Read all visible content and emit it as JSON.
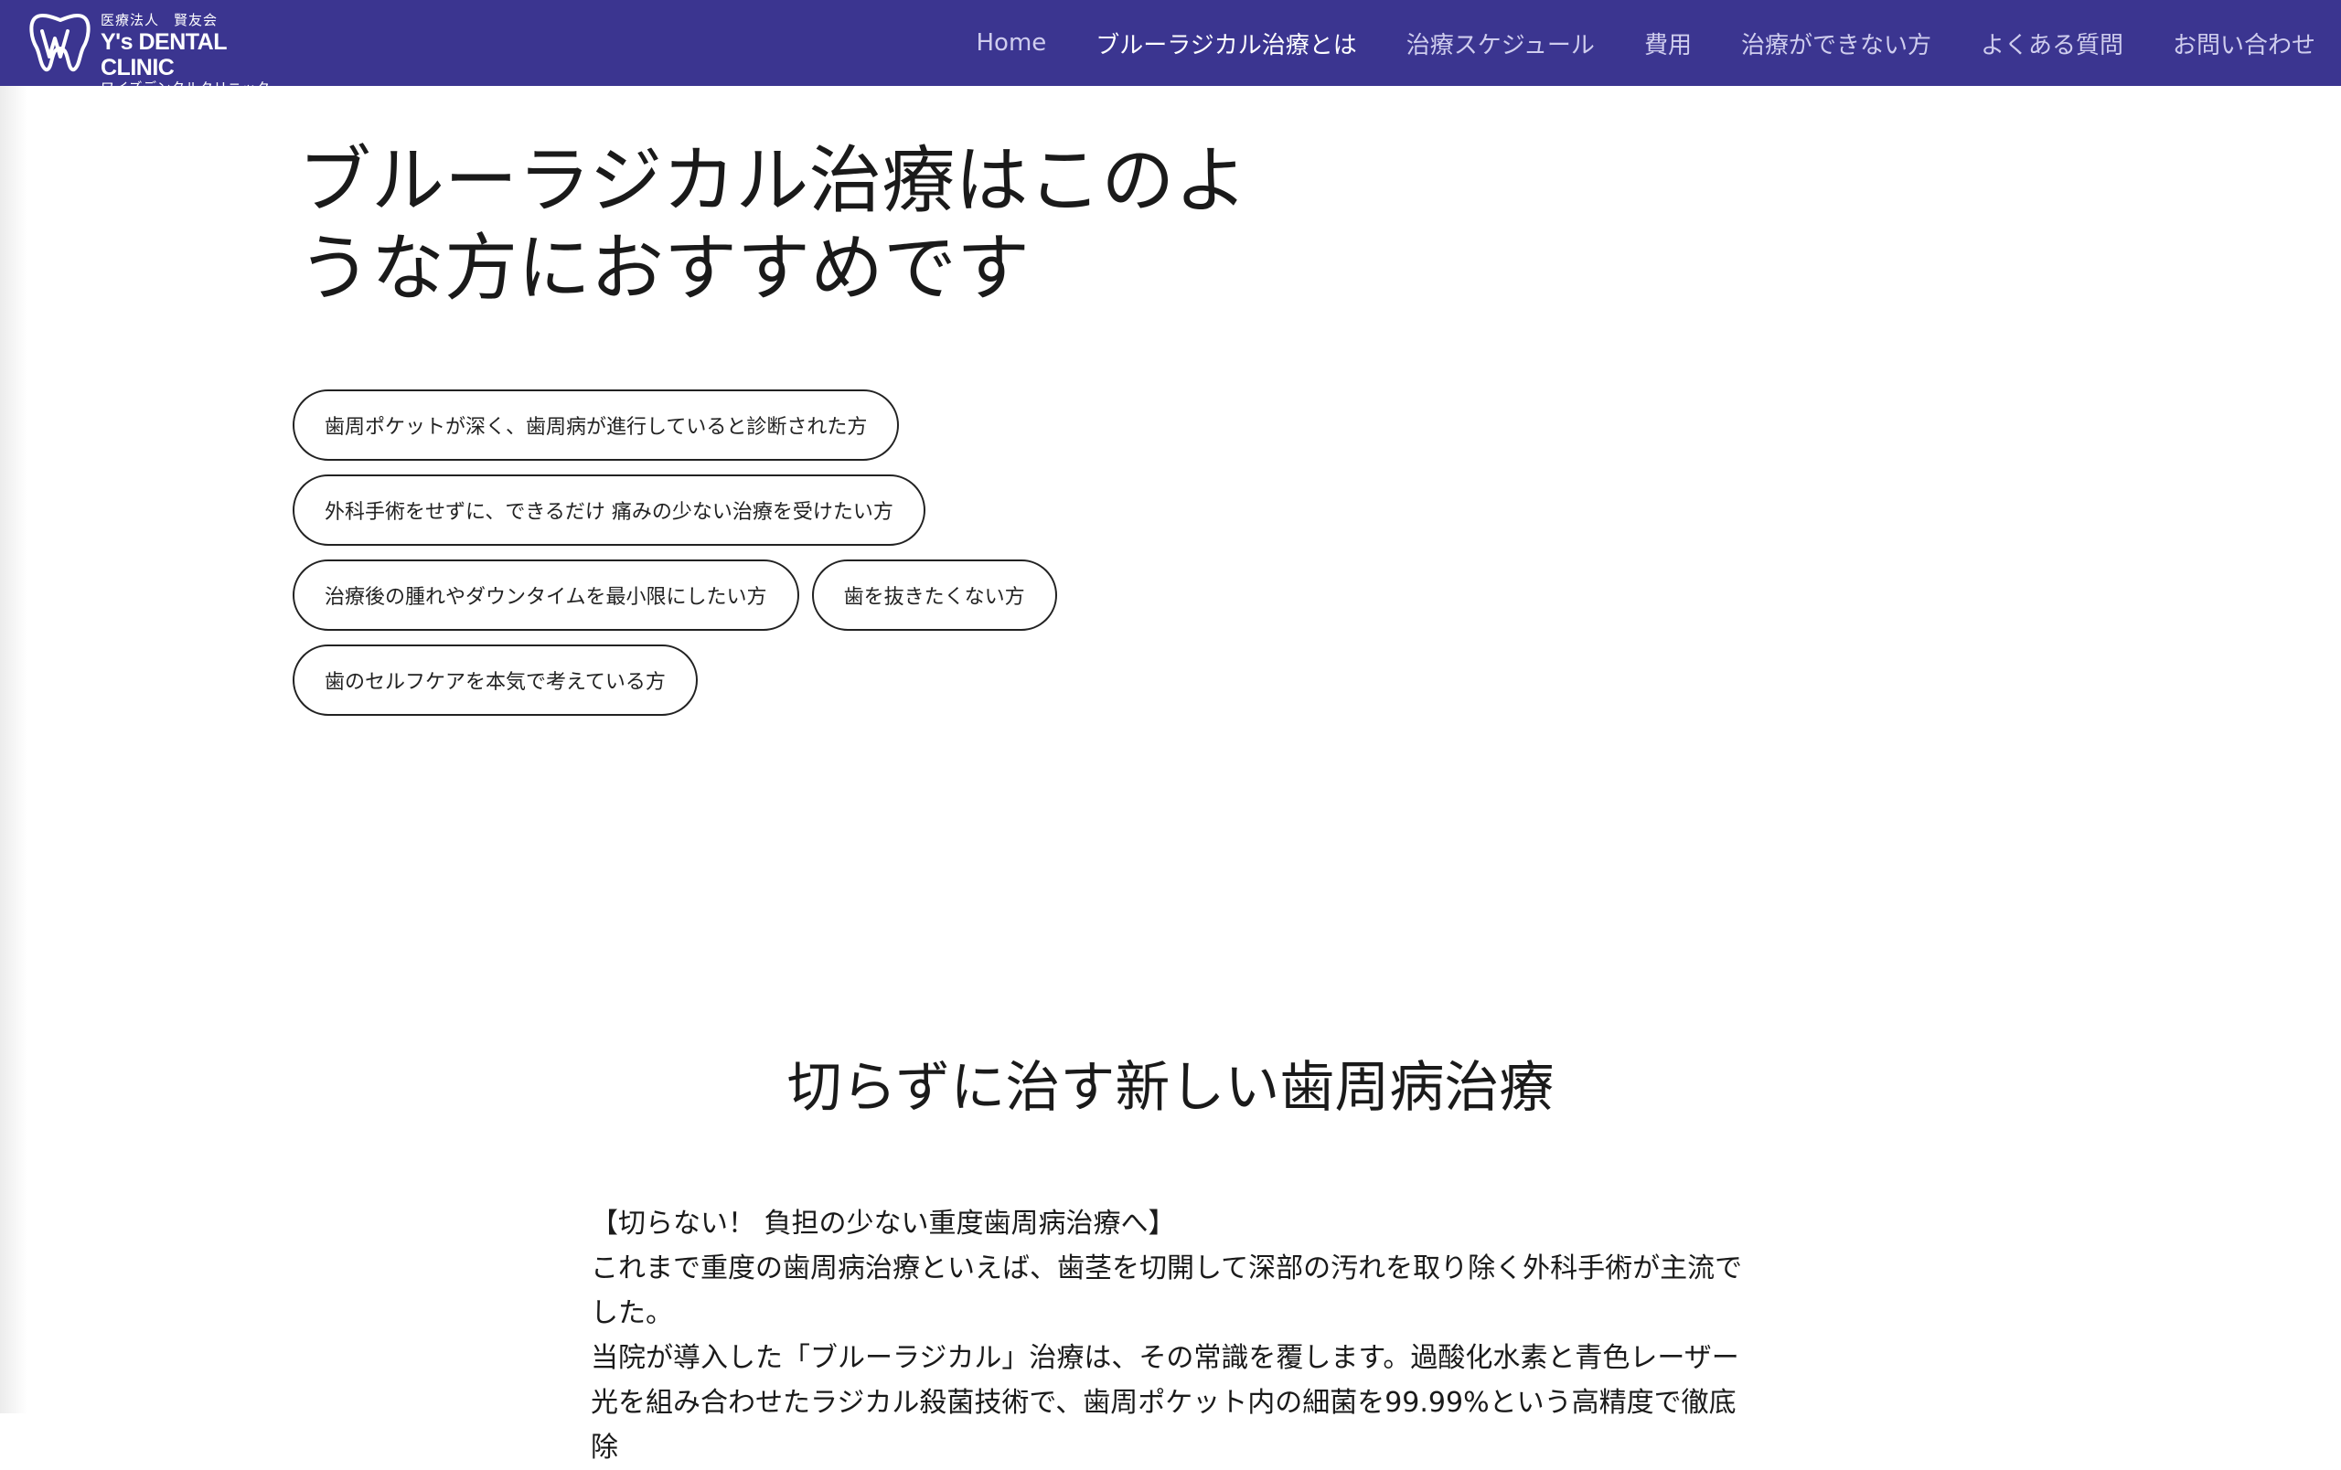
{
  "header": {
    "logo": {
      "corp": "医療法人　賢友会",
      "name": "Y's DENTAL CLINIC",
      "kana": "ワイズデンタルクリニック"
    },
    "nav": [
      {
        "label": "Home"
      },
      {
        "label": "ブルーラジカル治療とは"
      },
      {
        "label": "治療スケジュール"
      },
      {
        "label": "費用"
      },
      {
        "label": "治療ができない方"
      },
      {
        "label": "よくある質問"
      },
      {
        "label": "お問い合わせ"
      }
    ],
    "active_index": 1
  },
  "hero": {
    "title_line1": "ブルーラジカル治療はこのよ",
    "title_line2": "うな方におすすめです"
  },
  "recommendations": [
    "歯周ポケットが深く、歯周病が進行していると診断された方",
    "外科手術をせずに、できるだけ 痛みの少ない治療を受けたい方",
    "治療後の腫れやダウンタイムを最小限にしたい方",
    "歯を抜きたくない方",
    "歯のセルフケアを本気で考えている方"
  ],
  "section": {
    "title": "切らずに治す新しい歯周病治療",
    "paragraph1": "【切らない！ 負担の少ない重度歯周病治療へ】",
    "paragraph2": "これまで重度の歯周病治療といえば、歯茎を切開して深部の汚れを取り除く外科手術が主流でした。",
    "paragraph3": "当院が導入した「ブルーラジカル」治療は、その常識を覆します。過酸化水素と青色レーザー光を組み合わせたラジカル殺菌技術で、歯周ポケット内の細菌を99.99%という高精度で徹底除"
  },
  "colors": {
    "header_bg": "#3b3590",
    "nav_text": "#cfcdee",
    "nav_active": "#ffffff",
    "text": "#1a1a1a"
  },
  "icons": {
    "logo": "tooth-logo-icon"
  }
}
